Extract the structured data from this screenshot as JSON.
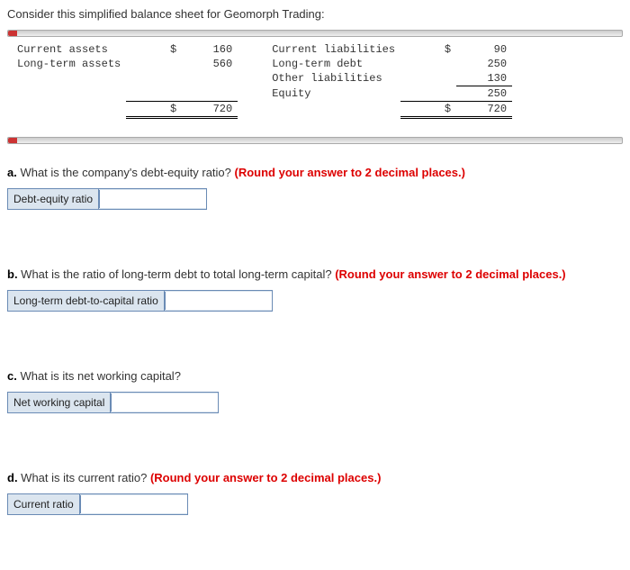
{
  "intro": "Consider this simplified balance sheet for Geomorph Trading:",
  "balance": {
    "left": [
      {
        "label": "Current assets",
        "cur": "$",
        "val": "160"
      },
      {
        "label": "Long-term assets",
        "cur": "",
        "val": "560"
      }
    ],
    "left_total": {
      "cur": "$",
      "val": "720"
    },
    "right": [
      {
        "label": "Current liabilities",
        "cur": "$",
        "val": "90"
      },
      {
        "label": "Long-term debt",
        "cur": "",
        "val": "250"
      },
      {
        "label": "Other liabilities",
        "cur": "",
        "val": "130"
      },
      {
        "label": "Equity",
        "cur": "",
        "val": "250"
      }
    ],
    "right_total": {
      "cur": "$",
      "val": "720"
    }
  },
  "questions": {
    "a": {
      "prefix": "a.",
      "text": " What is the company's debt-equity ratio? ",
      "hint": "(Round your answer to 2 decimal places.)",
      "input_label": "Debt-equity ratio"
    },
    "b": {
      "prefix": "b.",
      "text": " What is the ratio of long-term debt to total long-term capital? ",
      "hint": "(Round your answer to 2 decimal places.)",
      "input_label": "Long-term debt-to-capital ratio"
    },
    "c": {
      "prefix": "c.",
      "text": " What is its net working capital?",
      "hint": "",
      "input_label": "Net working capital"
    },
    "d": {
      "prefix": "d.",
      "text": " What is its current ratio? ",
      "hint": "(Round your answer to 2 decimal places.)",
      "input_label": "Current ratio"
    }
  },
  "chart_data": {
    "type": "table",
    "title": "Simplified balance sheet for Geomorph Trading",
    "assets": {
      "Current assets": 160,
      "Long-term assets": 560,
      "Total": 720
    },
    "liabilities_and_equity": {
      "Current liabilities": 90,
      "Long-term debt": 250,
      "Other liabilities": 130,
      "Equity": 250,
      "Total": 720
    }
  }
}
